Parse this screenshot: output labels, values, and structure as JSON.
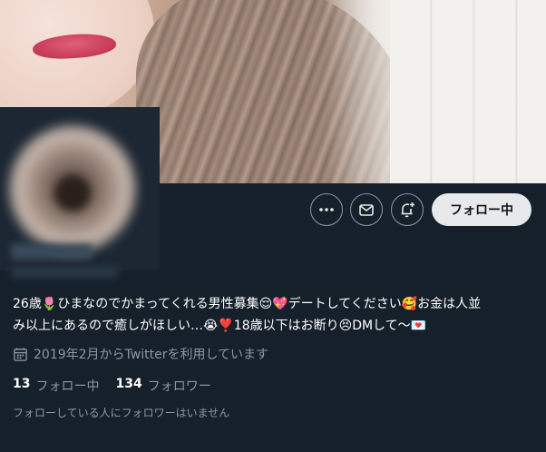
{
  "profile": {
    "bio_line1": "26歳🌷ひまなのでかまってくれる男性募集😌💖デートしてください🥰お金は人並",
    "bio_line2": "み以上にあるので癒しがほしい…😭❣️18歳以下はお断り😣DMして〜💌",
    "joined": "2019年2月からTwitterを利用しています",
    "following_count": "13",
    "following_label": "フォロー中",
    "followers_count": "134",
    "followers_label": "フォロワー",
    "mutual_note": "フォローしている人にフォロワーはいません"
  },
  "actions": {
    "more_icon": "more-icon",
    "message_icon": "mail-icon",
    "notify_icon": "bell-plus-icon",
    "follow_label": "フォロー中"
  },
  "colors": {
    "background": "#15202b",
    "secondary_text": "#8b98a5",
    "follow_button_bg": "#e7e9ea"
  }
}
